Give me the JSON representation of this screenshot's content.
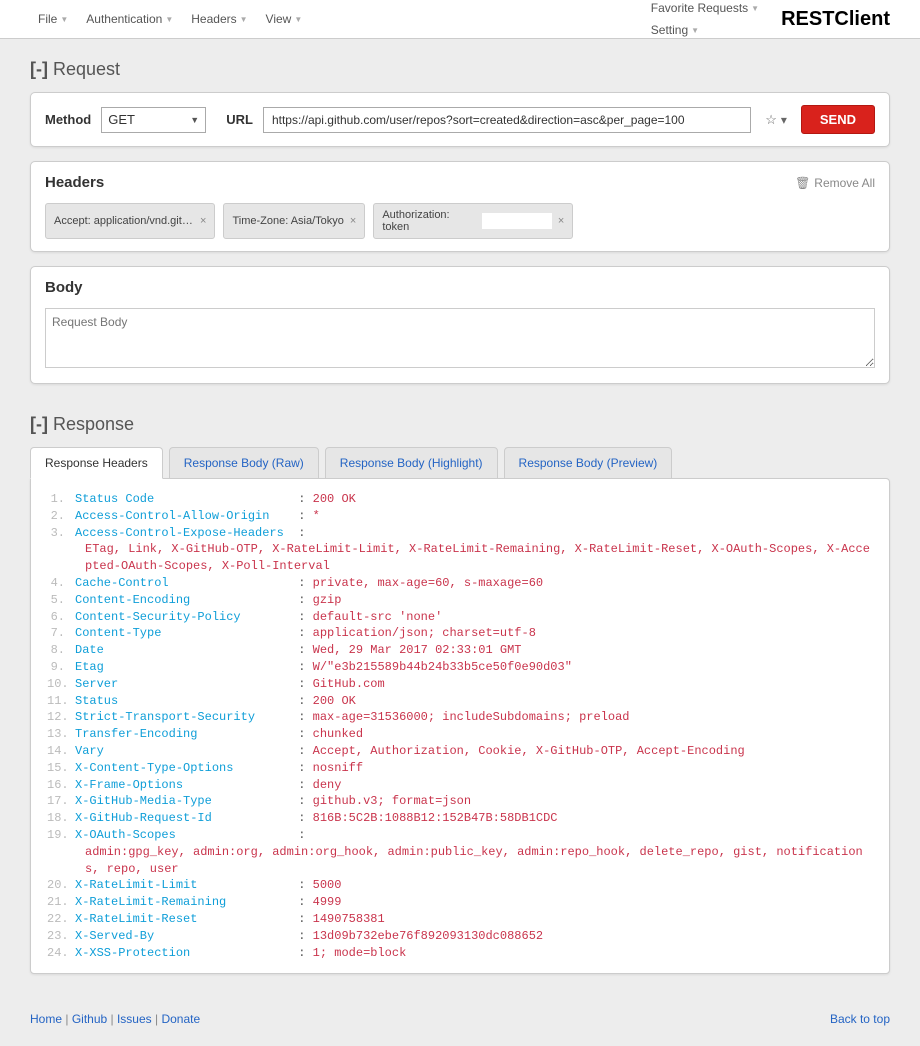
{
  "topbar": {
    "menus_left": [
      "File",
      "Authentication",
      "Headers",
      "View"
    ],
    "menus_right": [
      "Favorite Requests",
      "Setting"
    ],
    "brand": "RESTClient"
  },
  "request": {
    "title": "Request",
    "collapse": "[-]",
    "method_label": "Method",
    "method_value": "GET",
    "url_label": "URL",
    "url_value": "https://api.github.com/user/repos?sort=created&direction=asc&per_page=100",
    "star_icon": "☆",
    "caret_icon": "▾",
    "send_label": "SEND"
  },
  "headers": {
    "title": "Headers",
    "remove_all": "Remove All",
    "trash_icon": "🗑",
    "chips": [
      {
        "text": "Accept: application/vnd.github.v...",
        "has_input": false
      },
      {
        "text": "Time-Zone: Asia/Tokyo",
        "has_input": false
      },
      {
        "text": "Authorization: token ",
        "has_input": true
      }
    ],
    "close": "×"
  },
  "body_section": {
    "title": "Body",
    "placeholder": "Request Body"
  },
  "response": {
    "title": "Response",
    "collapse": "[-]",
    "tabs": [
      "Response Headers",
      "Response Body (Raw)",
      "Response Body (Highlight)",
      "Response Body (Preview)"
    ],
    "active_tab": 0,
    "headers": [
      {
        "n": "1",
        "k": "Status Code",
        "v": "200 OK"
      },
      {
        "n": "2",
        "k": "Access-Control-Allow-Origin",
        "v": "*"
      },
      {
        "n": "3",
        "k": "Access-Control-Expose-Headers",
        "v": "",
        "wrap": "ETag, Link, X-GitHub-OTP, X-RateLimit-Limit, X-RateLimit-Remaining, X-RateLimit-Reset, X-OAuth-Scopes, X-Accepted-OAuth-Scopes, X-Poll-Interval"
      },
      {
        "n": "4",
        "k": "Cache-Control",
        "v": "private, max-age=60, s-maxage=60"
      },
      {
        "n": "5",
        "k": "Content-Encoding",
        "v": "gzip"
      },
      {
        "n": "6",
        "k": "Content-Security-Policy",
        "v": "default-src 'none'"
      },
      {
        "n": "7",
        "k": "Content-Type",
        "v": "application/json; charset=utf-8"
      },
      {
        "n": "8",
        "k": "Date",
        "v": "Wed, 29 Mar 2017 02:33:01 GMT"
      },
      {
        "n": "9",
        "k": "Etag",
        "v": "W/\"e3b215589b44b24b33b5ce50f0e90d03\""
      },
      {
        "n": "10",
        "k": "Server",
        "v": "GitHub.com"
      },
      {
        "n": "11",
        "k": "Status",
        "v": "200 OK"
      },
      {
        "n": "12",
        "k": "Strict-Transport-Security",
        "v": "max-age=31536000; includeSubdomains; preload"
      },
      {
        "n": "13",
        "k": "Transfer-Encoding",
        "v": "chunked"
      },
      {
        "n": "14",
        "k": "Vary",
        "v": "Accept, Authorization, Cookie, X-GitHub-OTP, Accept-Encoding"
      },
      {
        "n": "15",
        "k": "X-Content-Type-Options",
        "v": "nosniff"
      },
      {
        "n": "16",
        "k": "X-Frame-Options",
        "v": "deny"
      },
      {
        "n": "17",
        "k": "X-GitHub-Media-Type",
        "v": "github.v3; format=json"
      },
      {
        "n": "18",
        "k": "X-GitHub-Request-Id",
        "v": "816B:5C2B:1088B12:152B47B:58DB1CDC"
      },
      {
        "n": "19",
        "k": "X-OAuth-Scopes",
        "v": "",
        "wrap": "admin:gpg_key, admin:org, admin:org_hook, admin:public_key, admin:repo_hook, delete_repo, gist, notifications, repo, user"
      },
      {
        "n": "20",
        "k": "X-RateLimit-Limit",
        "v": "5000"
      },
      {
        "n": "21",
        "k": "X-RateLimit-Remaining",
        "v": "4999"
      },
      {
        "n": "22",
        "k": "X-RateLimit-Reset",
        "v": "1490758381"
      },
      {
        "n": "23",
        "k": "X-Served-By",
        "v": "13d09b732ebe76f892093130dc088652"
      },
      {
        "n": "24",
        "k": "X-XSS-Protection",
        "v": "1; mode=block"
      }
    ]
  },
  "footer": {
    "links": [
      "Home",
      "Github",
      "Issues",
      "Donate"
    ],
    "back": "Back to top"
  }
}
